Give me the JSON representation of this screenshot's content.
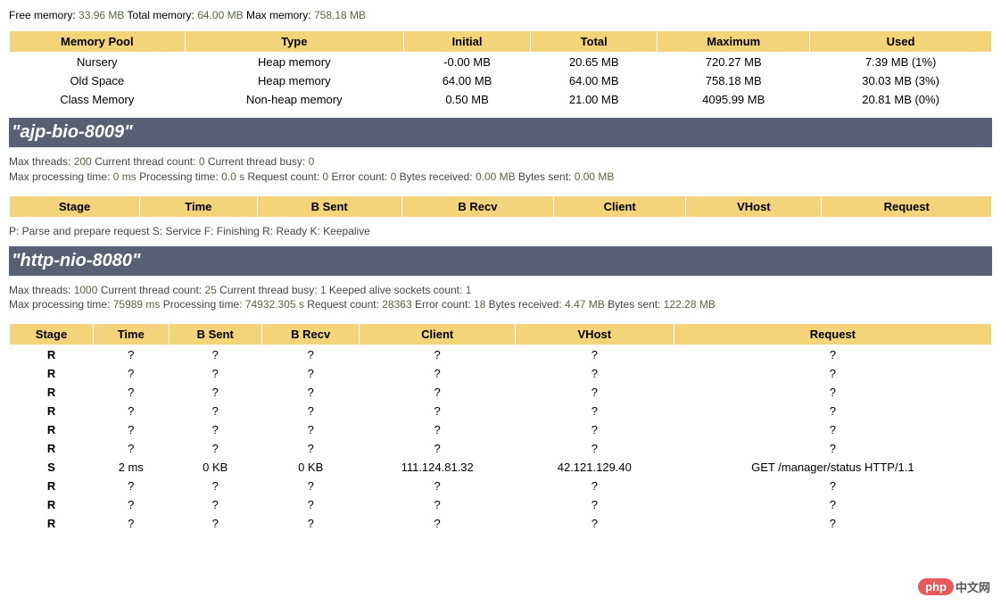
{
  "memory_summary": {
    "free_label": "Free memory:",
    "free_value": "33.96 MB",
    "total_label": "Total memory:",
    "total_value": "64.00 MB",
    "max_label": "Max memory:",
    "max_value": "758.18 MB"
  },
  "memory_pool": {
    "headers": [
      "Memory Pool",
      "Type",
      "Initial",
      "Total",
      "Maximum",
      "Used"
    ],
    "rows": [
      {
        "pool": "Nursery",
        "type": "Heap memory",
        "initial": "-0.00 MB",
        "total": "20.65 MB",
        "maximum": "720.27 MB",
        "used": "7.39 MB (1%)"
      },
      {
        "pool": "Old Space",
        "type": "Heap memory",
        "initial": "64.00 MB",
        "total": "64.00 MB",
        "maximum": "758.18 MB",
        "used": "30.03 MB (3%)"
      },
      {
        "pool": "Class Memory",
        "type": "Non-heap memory",
        "initial": "0.50 MB",
        "total": "21.00 MB",
        "maximum": "4095.99 MB",
        "used": "20.81 MB (0%)"
      }
    ]
  },
  "connectors": [
    {
      "name": "\"ajp-bio-8009\"",
      "stats_line1": {
        "max_threads_label": "Max threads:",
        "max_threads": "200",
        "current_count_label": "Current thread count:",
        "current_count": "0",
        "current_busy_label": "Current thread busy:",
        "current_busy": "0"
      },
      "stats_line2": {
        "max_processing_label": "Max processing time:",
        "max_processing": "0 ms",
        "processing_label": "Processing time:",
        "processing": "0.0 s",
        "request_count_label": "Request count:",
        "request_count": "0",
        "error_count_label": "Error count:",
        "error_count": "0",
        "bytes_received_label": "Bytes received:",
        "bytes_received": "0.00 MB",
        "bytes_sent_label": "Bytes sent:",
        "bytes_sent": "0.00 MB"
      },
      "thread_headers": [
        "Stage",
        "Time",
        "B Sent",
        "B Recv",
        "Client",
        "VHost",
        "Request"
      ],
      "threads": [],
      "legend": "P: Parse and prepare request S: Service F: Finishing R: Ready K: Keepalive"
    },
    {
      "name": "\"http-nio-8080\"",
      "stats_line1": {
        "max_threads_label": "Max threads:",
        "max_threads": "1000",
        "current_count_label": "Current thread count:",
        "current_count": "25",
        "current_busy_label": "Current thread busy:",
        "current_busy": "1",
        "keeped_alive_label": "Keeped alive sockets count:",
        "keeped_alive": "1"
      },
      "stats_line2": {
        "max_processing_label": "Max processing time:",
        "max_processing": "75989 ms",
        "processing_label": "Processing time:",
        "processing": "74932.305 s",
        "request_count_label": "Request count:",
        "request_count": "28363",
        "error_count_label": "Error count:",
        "error_count": "18",
        "bytes_received_label": "Bytes received:",
        "bytes_received": "4.47 MB",
        "bytes_sent_label": "Bytes sent:",
        "bytes_sent": "122.28 MB"
      },
      "thread_headers": [
        "Stage",
        "Time",
        "B Sent",
        "B Recv",
        "Client",
        "VHost",
        "Request"
      ],
      "threads": [
        {
          "stage": "R",
          "time": "?",
          "bsent": "?",
          "brecv": "?",
          "client": "?",
          "vhost": "?",
          "request": "?"
        },
        {
          "stage": "R",
          "time": "?",
          "bsent": "?",
          "brecv": "?",
          "client": "?",
          "vhost": "?",
          "request": "?"
        },
        {
          "stage": "R",
          "time": "?",
          "bsent": "?",
          "brecv": "?",
          "client": "?",
          "vhost": "?",
          "request": "?"
        },
        {
          "stage": "R",
          "time": "?",
          "bsent": "?",
          "brecv": "?",
          "client": "?",
          "vhost": "?",
          "request": "?"
        },
        {
          "stage": "R",
          "time": "?",
          "bsent": "?",
          "brecv": "?",
          "client": "?",
          "vhost": "?",
          "request": "?"
        },
        {
          "stage": "R",
          "time": "?",
          "bsent": "?",
          "brecv": "?",
          "client": "?",
          "vhost": "?",
          "request": "?"
        },
        {
          "stage": "S",
          "time": "2 ms",
          "bsent": "0 KB",
          "brecv": "0 KB",
          "client": "111.124.81.32",
          "vhost": "42.121.129.40",
          "request": "GET /manager/status HTTP/1.1"
        },
        {
          "stage": "R",
          "time": "?",
          "bsent": "?",
          "brecv": "?",
          "client": "?",
          "vhost": "?",
          "request": "?"
        },
        {
          "stage": "R",
          "time": "?",
          "bsent": "?",
          "brecv": "?",
          "client": "?",
          "vhost": "?",
          "request": "?"
        },
        {
          "stage": "R",
          "time": "?",
          "bsent": "?",
          "brecv": "?",
          "client": "?",
          "vhost": "?",
          "request": "?"
        }
      ]
    }
  ],
  "logo": {
    "pill": "php",
    "text": "中文网"
  },
  "chart_data": {
    "type": "table",
    "memory_pools": [
      {
        "pool": "Nursery",
        "type": "Heap memory",
        "initial_mb": 0.0,
        "total_mb": 20.65,
        "maximum_mb": 720.27,
        "used_mb": 7.39,
        "used_pct": 1
      },
      {
        "pool": "Old Space",
        "type": "Heap memory",
        "initial_mb": 64.0,
        "total_mb": 64.0,
        "maximum_mb": 758.18,
        "used_mb": 30.03,
        "used_pct": 3
      },
      {
        "pool": "Class Memory",
        "type": "Non-heap memory",
        "initial_mb": 0.5,
        "total_mb": 21.0,
        "maximum_mb": 4095.99,
        "used_mb": 20.81,
        "used_pct": 0
      }
    ]
  }
}
